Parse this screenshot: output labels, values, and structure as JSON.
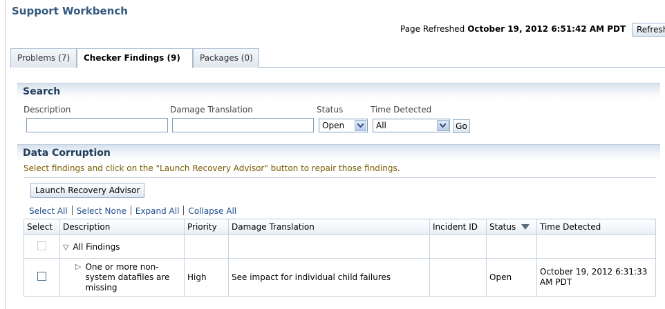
{
  "page": {
    "title": "Support Workbench",
    "refreshed_label": "Page Refreshed",
    "refreshed_time": "October 19, 2012 6:51:42 AM PDT",
    "refresh_button": "Refresh"
  },
  "tabs": [
    {
      "label": "Problems (7)",
      "active": false
    },
    {
      "label": "Checker Findings (9)",
      "active": true
    },
    {
      "label": "Packages (0)",
      "active": false
    }
  ],
  "search": {
    "header": "Search",
    "description_label": "Description",
    "description_value": "",
    "damage_label": "Damage Translation",
    "damage_value": "",
    "status_label": "Status",
    "status_value": "Open",
    "time_label": "Time Detected",
    "time_value": "All",
    "go_button": "Go"
  },
  "corruption": {
    "header": "Data Corruption",
    "instruction": "Select findings and click on the \"Launch Recovery Advisor\" button to repair those findings.",
    "launch_button": "Launch Recovery Advisor",
    "links": [
      "Select All",
      "Select None",
      "Expand All",
      "Collapse All"
    ]
  },
  "table": {
    "headers": [
      "Select",
      "Description",
      "Priority",
      "Damage Translation",
      "Incident ID",
      "Status",
      "Time Detected"
    ],
    "group_row": {
      "description": "All Findings"
    },
    "rows": [
      {
        "description": "One or more non-system datafiles are missing",
        "priority": "High",
        "damage": "See impact for individual child failures",
        "incident_id": "",
        "status": "Open",
        "time": "October 19, 2012 6:31:33 AM PDT"
      }
    ]
  },
  "colors": {
    "title": "#33597e",
    "link": "#1f4f8f",
    "instruction": "#7a5a00"
  }
}
